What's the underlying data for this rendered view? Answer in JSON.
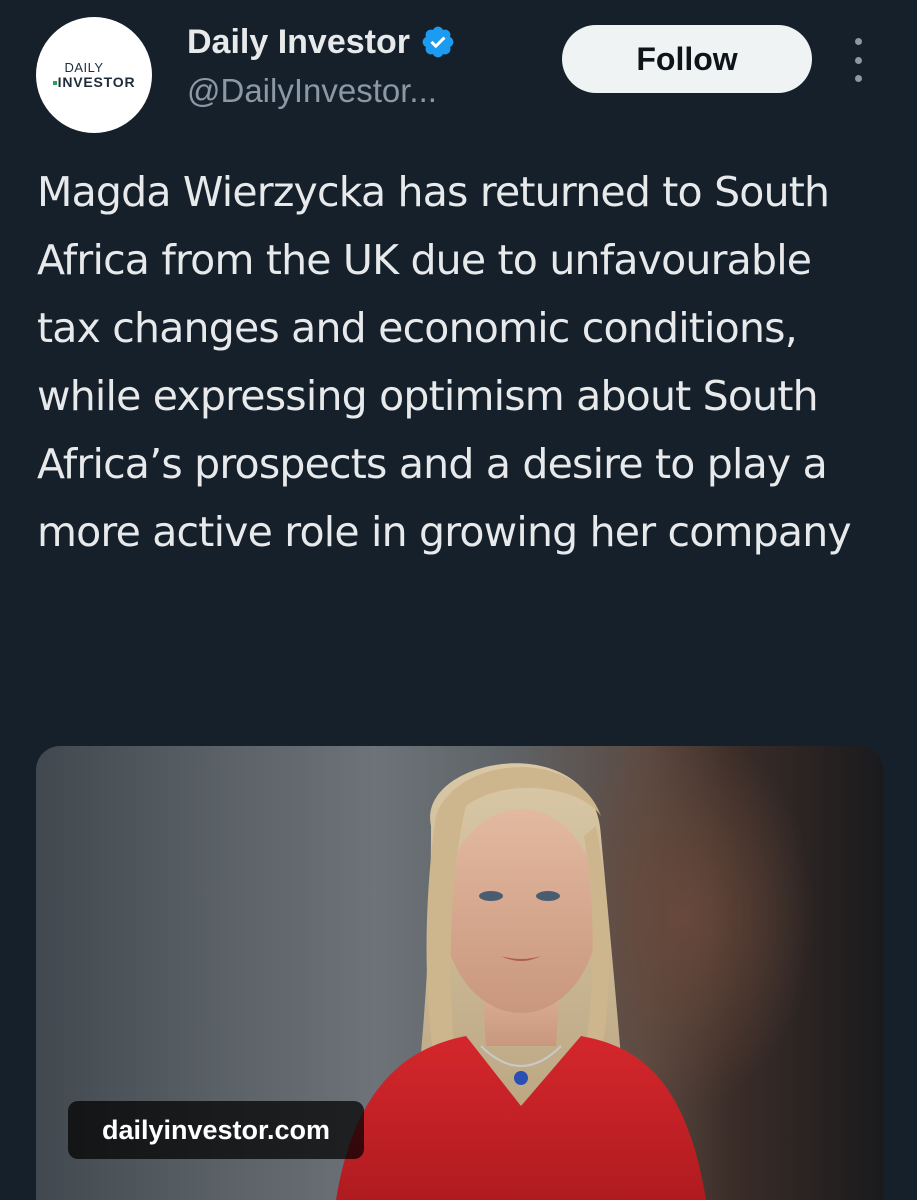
{
  "author": {
    "avatar_text_line1": "DAILY",
    "avatar_text_line2": "INVESTOR",
    "display_name": "Daily Investor",
    "handle": "@DailyInvestor...",
    "verified": true
  },
  "actions": {
    "follow_label": "Follow"
  },
  "tweet": {
    "text": "Magda Wierzycka has returned to South Africa from the UK due to unfavourable tax changes and economic conditions, while expressing optimism about South Africa’s prospects and a desire to play a more active role in growing her company"
  },
  "media": {
    "link_domain": "dailyinvestor.com"
  },
  "colors": {
    "background": "#15202b",
    "text_primary": "#e7e9ea",
    "text_secondary": "#8b98a5",
    "verified_badge": "#1d9bf0",
    "follow_button_bg": "#eff3f4"
  },
  "icons": [
    "verified-badge-icon",
    "more-options-icon"
  ]
}
